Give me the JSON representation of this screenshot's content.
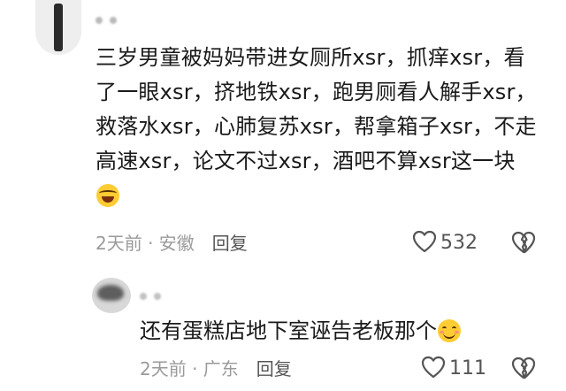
{
  "comments": [
    {
      "text": "三岁男童被妈妈带进女厕所xsr，抓痒xsr，看了一眼xsr，挤地铁xsr，跑男厕看人解手xsr，救落水xsr，心肺复苏xsr，帮拿箱子xsr，不走高速xsr，论文不过xsr，酒吧不算xsr这一块",
      "emoji": "laughing-crying-emoji",
      "meta": "2天前 · 安徽",
      "reply_label": "回复",
      "likes": "532"
    },
    {
      "text": "还有蛋糕店地下室诬告老板那个",
      "emoji": "smiling-face-emoji",
      "meta": "2天前 · 广东",
      "reply_label": "回复",
      "likes": "111"
    }
  ],
  "colors": {
    "text": "#1a1a1a",
    "meta": "#9a9a9a",
    "icon": "#555555",
    "background": "#ffffff"
  }
}
